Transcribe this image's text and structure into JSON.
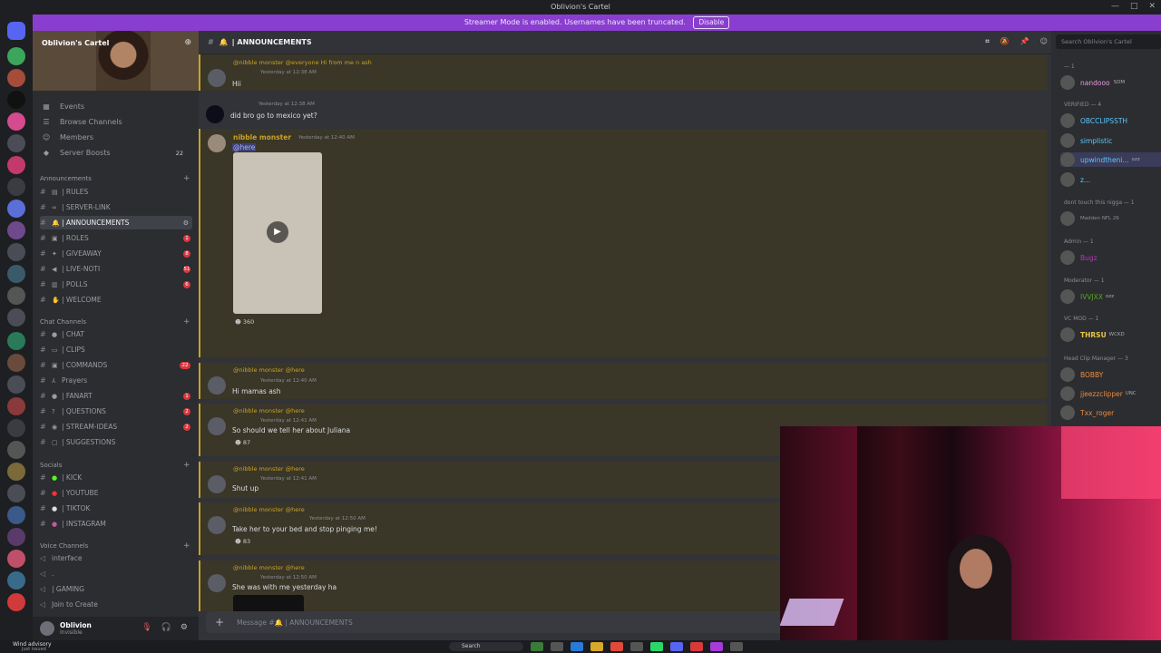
{
  "window": {
    "title": "Oblivion's Cartel",
    "controls": [
      "—",
      "□",
      "✕"
    ]
  },
  "banner": {
    "text": "Streamer Mode is enabled. Usernames have been truncated.",
    "button": "Disable"
  },
  "server": {
    "name": "Oblivion's Cartel"
  },
  "nav": [
    {
      "label": "Events",
      "badge": ""
    },
    {
      "label": "Browse Channels",
      "badge": ""
    },
    {
      "label": "Members",
      "badge": ""
    },
    {
      "label": "Server Boosts",
      "badge": "22"
    }
  ],
  "categories": {
    "announcements": "Announcements",
    "chat": "Chat Channels",
    "socials": "Socials",
    "voice": "Voice Channels"
  },
  "channels_announcements": [
    {
      "name": "| RULES",
      "badge": ""
    },
    {
      "name": "| SERVER-LINK",
      "badge": ""
    },
    {
      "name": "| ANNOUNCEMENTS",
      "badge": ""
    },
    {
      "name": "| ROLES",
      "badge": "1"
    },
    {
      "name": "| GIVEAWAY",
      "badge": "8"
    },
    {
      "name": "| LIVE-NOTI",
      "badge": "51"
    },
    {
      "name": "| POLLS",
      "badge": "6"
    },
    {
      "name": "| WELCOME",
      "badge": ""
    }
  ],
  "channels_chat": [
    {
      "name": "| CHAT",
      "badge": ""
    },
    {
      "name": "| CLIPS",
      "badge": ""
    },
    {
      "name": "| COMMANDS",
      "badge": "22"
    },
    {
      "name": "Prayers",
      "badge": ""
    },
    {
      "name": "| FANART",
      "badge": "1"
    },
    {
      "name": "| QUESTIONS",
      "badge": "2"
    },
    {
      "name": "| STREAM-IDEAS",
      "badge": "2"
    },
    {
      "name": "| SUGGESTIONS",
      "badge": ""
    }
  ],
  "channels_social": [
    {
      "name": "| KICK"
    },
    {
      "name": "| YOUTUBE"
    },
    {
      "name": "| TIKTOK"
    },
    {
      "name": "| INSTAGRAM"
    }
  ],
  "channels_voice": [
    {
      "name": "interface"
    },
    {
      "name": "."
    },
    {
      "name": "| GAMING"
    },
    {
      "name": "Join to Create"
    }
  ],
  "user": {
    "name": "Oblivion",
    "status": "Invisible"
  },
  "channel_header": {
    "title": "| ANNOUNCEMENTS"
  },
  "search": {
    "placeholder": "Search Oblivion's Cartel"
  },
  "messages": [
    {
      "reply": "@nibble monster @everyone Hi from me n ash",
      "meta": "Yesterday at 12:38 AM",
      "text": "Hii",
      "react": ""
    },
    {
      "reply": "",
      "meta": "Yesterday at 12:38 AM",
      "text": "did bro go to mexico yet?",
      "react": ""
    },
    {
      "reply": "nibble monster",
      "meta": "Yesterday at 12:40 AM",
      "text": "@here",
      "react": "360"
    },
    {
      "reply": "@nibble monster @here",
      "meta": "Yesterday at 12:40 AM",
      "text": "Hi mamas ash",
      "react": ""
    },
    {
      "reply": "@nibble monster @here",
      "meta": "Yesterday at 12:41 AM",
      "text": "So should we tell her about Juliana",
      "react": "87"
    },
    {
      "reply": "@nibble monster @here",
      "meta": "Yesterday at 12:41 AM",
      "text": "Shut up",
      "react": ""
    },
    {
      "reply": "@nibble monster @here",
      "meta": "Yesterday at 12:50 AM",
      "text": "Take her to your bed and stop pinging me!",
      "react": "83"
    },
    {
      "reply": "@nibble monster @here",
      "meta": "Yesterday at 12:50 AM",
      "text": "She was with me yesterday ha",
      "react": ""
    }
  ],
  "composer": {
    "placeholder": "Message #🔔 | ANNOUNCEMENTS"
  },
  "member_groups": [
    {
      "label": "— 1",
      "members": [
        {
          "name": "nandooo",
          "color": "#e89ad9",
          "tag": "SDM"
        }
      ]
    },
    {
      "label": "VERIFIED — 4",
      "members": [
        {
          "name": "OBCCLIPSSTH",
          "color": "#5cc8ff",
          "tag": ""
        },
        {
          "name": "simplistic",
          "color": "#5cc8ff",
          "tag": ""
        },
        {
          "name": "upwindtheni...",
          "color": "#5cc8ff",
          "tag": "ozz"
        },
        {
          "name": "z...",
          "color": "#5cc8ff",
          "tag": ""
        }
      ]
    },
    {
      "label": "dont touch this nigga — 1",
      "members": [
        {
          "name": "Madden NFL 26",
          "color": "#8a8d93",
          "tag": ""
        }
      ]
    },
    {
      "label": "Admin — 1",
      "members": [
        {
          "name": "Bugz",
          "color": "#b03bb3",
          "tag": ""
        }
      ]
    },
    {
      "label": "Moderator — 1",
      "members": [
        {
          "name": "IVVJXX",
          "color": "#5aa02c",
          "tag": "ozz"
        }
      ]
    },
    {
      "label": "VC MOD — 1",
      "members": [
        {
          "name": "THRSU",
          "color": "#e8c547",
          "tag": "WCKD"
        }
      ]
    },
    {
      "label": "Head Clip Manager — 3",
      "members": [
        {
          "name": "BOBBY",
          "color": "#f08a3a",
          "tag": ""
        },
        {
          "name": "jjeezzclipper",
          "color": "#f08a3a",
          "tag": "UNC"
        },
        {
          "name": "Txx_roger",
          "color": "#f08a3a",
          "tag": ""
        }
      ]
    }
  ],
  "taskbar": {
    "weather": "Wind advisory",
    "weather_sub": "Just issued",
    "search": "Search"
  }
}
